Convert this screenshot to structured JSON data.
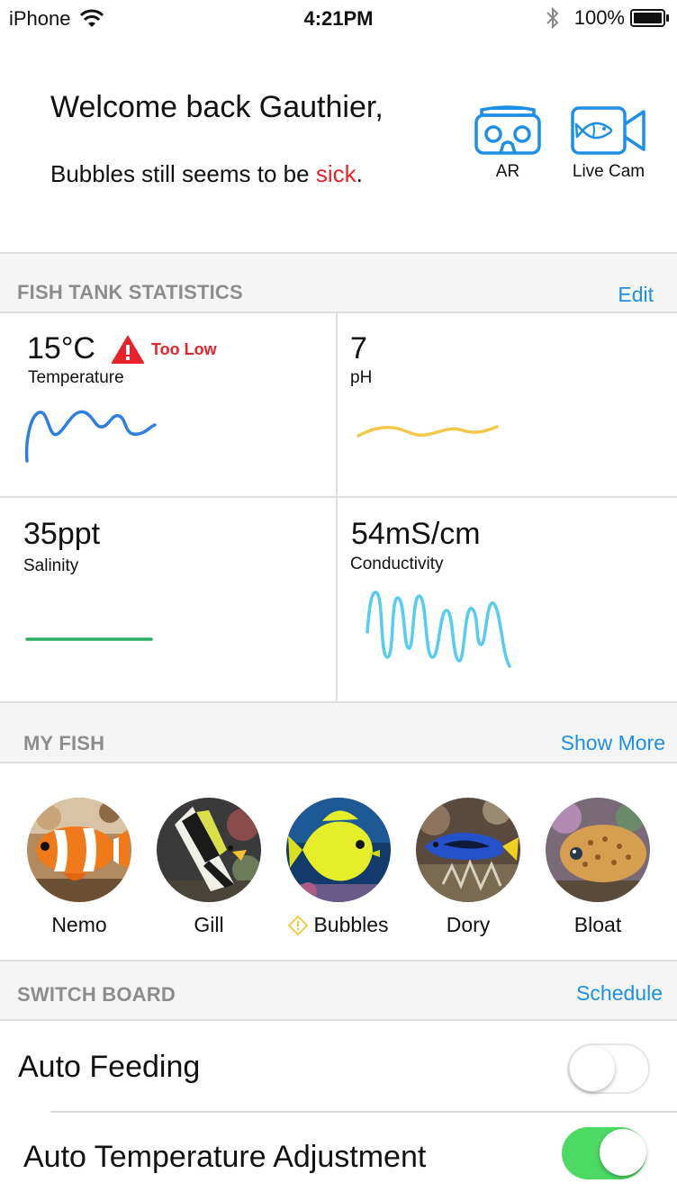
{
  "status_bar": {
    "carrier": "iPhone",
    "time": "4:21PM",
    "battery": "100%"
  },
  "greeting": {
    "welcome": "Welcome back Gauthier,",
    "message_prefix": "Bubbles still seems to be ",
    "message_status": "sick",
    "message_suffix": "."
  },
  "actions": {
    "ar_label": "AR",
    "live_cam_label": "Live Cam"
  },
  "stats": {
    "title": "FISH TANK STATISTICS",
    "edit_label": "Edit",
    "temperature": {
      "value": "15°C",
      "label": "Temperature",
      "alert": "Too Low"
    },
    "ph": {
      "value": "7",
      "label": "pH"
    },
    "salinity": {
      "value": "35ppt",
      "label": "Salinity"
    },
    "conductivity": {
      "value": "54mS/cm",
      "label": "Conductivity"
    },
    "colors": {
      "temperature": "#2f7fe0",
      "ph": "#f2c94c",
      "salinity": "#27ae60",
      "conductivity": "#56ccf2",
      "alert": "#e8222a"
    }
  },
  "my_fish": {
    "title": "MY FISH",
    "show_more_label": "Show More",
    "fish": [
      {
        "name": "Nemo"
      },
      {
        "name": "Gill"
      },
      {
        "name": "Bubbles",
        "warning": true
      },
      {
        "name": "Dory"
      },
      {
        "name": "Bloat"
      }
    ]
  },
  "switch_board": {
    "title": "SWITCH BOARD",
    "schedule_label": "Schedule",
    "toggles": [
      {
        "label": "Auto Feeding",
        "on": false
      },
      {
        "label": "Auto Temperature Adjustment",
        "on": true
      }
    ]
  },
  "accent_color": "#1e8fe6"
}
